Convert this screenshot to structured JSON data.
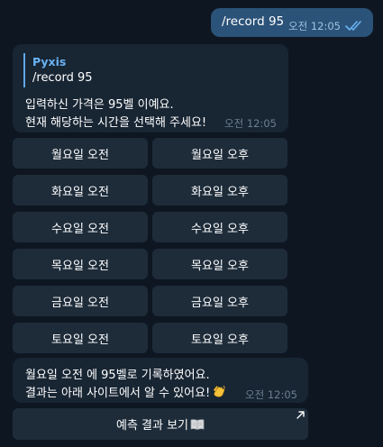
{
  "outgoing": {
    "text": "/record 95",
    "time": "오전 12:05"
  },
  "reply": {
    "quote_name": "Pyxis",
    "quote_text": "/record 95",
    "lines": [
      "입력하신 가격은 95벨 이예요.",
      "현재 해당하는 시간을 선택해 주세요!"
    ],
    "time": "오전 12:05"
  },
  "keyboard": [
    [
      "월요일 오전",
      "월요일 오후"
    ],
    [
      "화요일 오전",
      "화요일 오후"
    ],
    [
      "수요일 오전",
      "수요일 오후"
    ],
    [
      "목요일 오전",
      "목요일 오후"
    ],
    [
      "금요일 오전",
      "금요일 오후"
    ],
    [
      "토요일 오전",
      "토요일 오후"
    ]
  ],
  "result": {
    "lines": [
      "월요일 오전 에 95벨로 기록하였어요.",
      "결과는 아래 사이트에서 알 수 있어요!"
    ],
    "emoji_icon": "clapping-hands-icon",
    "time": "오전 12:05"
  },
  "link_button": {
    "label": "예측 결과 보기",
    "icon": "book-icon",
    "corner_icon": "open-link-arrow-icon"
  },
  "colors": {
    "background": "#0e1621",
    "outgoing_bubble": "#2b5278",
    "incoming_bubble": "#182533",
    "button": "#1e2c3a",
    "accent": "#6ab3f3"
  }
}
